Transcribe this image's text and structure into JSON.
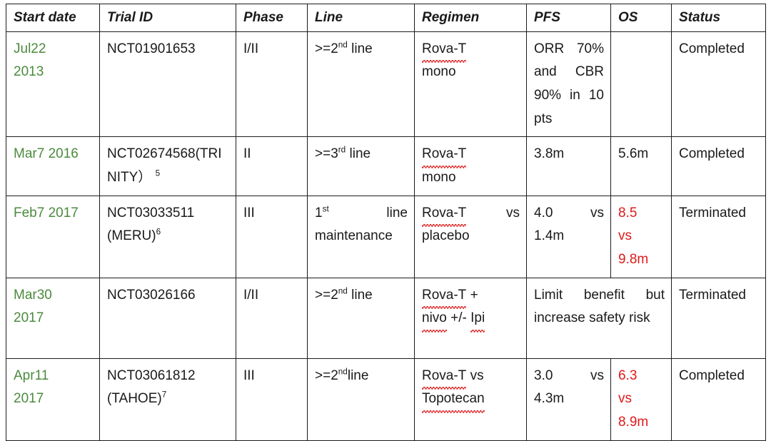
{
  "table": {
    "columns": [
      {
        "key": "start_date",
        "label": "Start date"
      },
      {
        "key": "trial_id",
        "label": "Trial ID"
      },
      {
        "key": "phase",
        "label": "Phase"
      },
      {
        "key": "line",
        "label": "Line"
      },
      {
        "key": "regimen",
        "label": "Regimen"
      },
      {
        "key": "pfs",
        "label": "PFS"
      },
      {
        "key": "os",
        "label": "OS"
      },
      {
        "key": "status",
        "label": "Status"
      }
    ],
    "colors": {
      "date_green": "#4b8a3c",
      "os_red": "#df1a1a",
      "border": "#1c1c1c",
      "text": "#1a1a1a",
      "spellcheck_underline": "#e02020"
    },
    "rows": [
      {
        "start_date_line1": "Jul22",
        "start_date_line2": "2013",
        "trial_id": "NCT01901653",
        "phase": "I/II",
        "line_prefix": ">=2",
        "line_sup": "nd",
        "line_suffix": " line",
        "regimen_drug": "Rova-T",
        "regimen_rest": "mono",
        "pfs": "ORR 70% and CBR 90% in 10 pts",
        "pfs_misspelled": "pts",
        "os": "",
        "os_highlight": false,
        "status": "Completed"
      },
      {
        "start_date_line1": "Mar7 2016",
        "start_date_line2": "",
        "trial_id": "NCT02674568(TRINITY）",
        "trial_id_sup": "5",
        "phase": "II",
        "line_prefix": ">=3",
        "line_sup": "rd",
        "line_suffix": " line",
        "regimen_drug": "Rova-T",
        "regimen_rest": "mono",
        "pfs": "3.8m",
        "os": "5.6m",
        "os_highlight": false,
        "status": "Completed"
      },
      {
        "start_date_line1": "Feb7 2017",
        "start_date_line2": "",
        "trial_id": "NCT03033511 (MERU)",
        "trial_id_sup": "6",
        "phase": "III",
        "line_prefix": "1",
        "line_sup": "st",
        "line_suffix": " line maintenance",
        "regimen_drug": "Rova-T",
        "regimen_rest": " vs placebo",
        "pfs": "4.0 vs 1.4m",
        "os_lines": [
          "8.5",
          "vs",
          "9.8m"
        ],
        "os_highlight": true,
        "status": "Terminated"
      },
      {
        "start_date_line1": "Mar30",
        "start_date_line2": "2017",
        "trial_id": "NCT03026166",
        "phase": "I/II",
        "line_prefix": ">=2",
        "line_sup": "nd",
        "line_suffix": " line",
        "regimen_drug": "Rova-T",
        "regimen_plus": " +",
        "regimen_drug2": "nivo",
        "regimen_mid": " +/- ",
        "regimen_drug3": "Ipi",
        "pfs": "Limit benefit but increase safety risk",
        "pfs_spans_os": true,
        "os_highlight": false,
        "status": "Terminated"
      },
      {
        "start_date_line1": "Apr11",
        "start_date_line2": "2017",
        "trial_id": "NCT03061812 (TAHOE)",
        "trial_id_sup": "7",
        "phase": "III",
        "line_prefix": ">=2",
        "line_sup": "nd",
        "line_suffix": "line",
        "regimen_drug": "Rova-T",
        "regimen_rest": " vs ",
        "regimen_drug2": "Topotecan",
        "pfs": "3.0 vs 4.3m",
        "os_lines": [
          "6.3",
          "vs",
          "8.9m"
        ],
        "os_highlight": true,
        "status": "Completed"
      }
    ]
  }
}
